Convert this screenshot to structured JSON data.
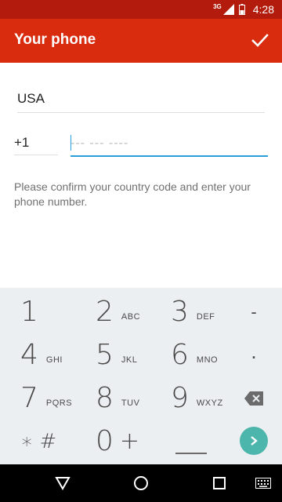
{
  "status_bar": {
    "network": "3G",
    "time": "4:28"
  },
  "app_bar": {
    "title": "Your phone"
  },
  "form": {
    "country": "USA",
    "country_code": "+1",
    "phone_placeholder": "--- --- ----",
    "phone_value": "",
    "hint": "Please confirm your country code and enter your phone number."
  },
  "keypad": {
    "keys": [
      {
        "num": "1",
        "letters": ""
      },
      {
        "num": "2",
        "letters": "ABC"
      },
      {
        "num": "3",
        "letters": "DEF"
      },
      {
        "num": "4",
        "letters": "GHI"
      },
      {
        "num": "5",
        "letters": "JKL"
      },
      {
        "num": "6",
        "letters": "MNO"
      },
      {
        "num": "7",
        "letters": "PQRS"
      },
      {
        "num": "8",
        "letters": "TUV"
      },
      {
        "num": "9",
        "letters": "WXYZ"
      },
      {
        "num": "0",
        "letters": "+"
      }
    ],
    "star_hash": "∗ #",
    "dash": "-",
    "dot": "."
  },
  "colors": {
    "status_bar": "#b31b0c",
    "app_bar": "#d92b0e",
    "accent": "#2a9ed8",
    "next_button": "#4db6ac",
    "keypad_bg": "#eceff1"
  }
}
